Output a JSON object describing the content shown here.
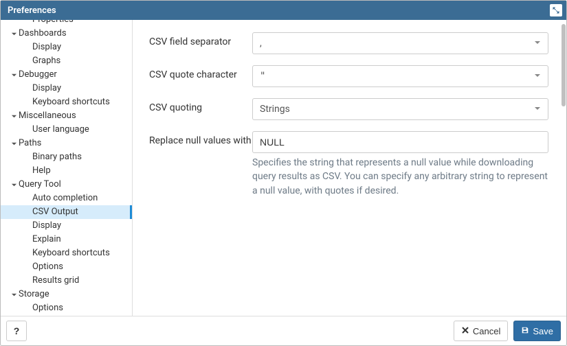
{
  "window": {
    "title": "Preferences"
  },
  "sidebar": {
    "truncated_top": "Properties",
    "groups": [
      {
        "label": "Dashboards",
        "expanded": true,
        "items": [
          "Display",
          "Graphs"
        ]
      },
      {
        "label": "Debugger",
        "expanded": true,
        "items": [
          "Display",
          "Keyboard shortcuts"
        ]
      },
      {
        "label": "Miscellaneous",
        "expanded": true,
        "items": [
          "User language"
        ]
      },
      {
        "label": "Paths",
        "expanded": true,
        "items": [
          "Binary paths",
          "Help"
        ]
      },
      {
        "label": "Query Tool",
        "expanded": true,
        "items": [
          "Auto completion",
          "CSV Output",
          "Display",
          "Explain",
          "Keyboard shortcuts",
          "Options",
          "Results grid"
        ],
        "selected_item": "CSV Output"
      },
      {
        "label": "Storage",
        "expanded": true,
        "items": [
          "Options"
        ]
      }
    ]
  },
  "form": {
    "csv_field_separator": {
      "label": "CSV field separator",
      "value": ","
    },
    "csv_quote_character": {
      "label": "CSV quote character",
      "value": "\""
    },
    "csv_quoting": {
      "label": "CSV quoting",
      "value": "Strings"
    },
    "replace_null": {
      "label": "Replace null values with",
      "value": "NULL",
      "help": "Specifies the string that represents a null value while downloading query results as CSV. You can specify any arbitrary string to represent a null value, with quotes if desired."
    }
  },
  "footer": {
    "help": "?",
    "cancel": "Cancel",
    "save": "Save"
  }
}
